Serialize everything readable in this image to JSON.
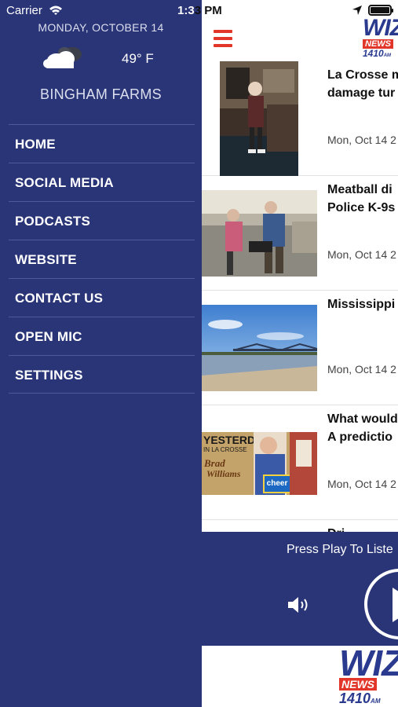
{
  "status_bar": {
    "carrier": "Carrier",
    "time_left": "1:3",
    "time_right": "3 PM",
    "icons": [
      "wifi-icon",
      "location-arrow-icon",
      "battery-icon"
    ]
  },
  "drawer": {
    "date": "MONDAY, OCTOBER 14",
    "weather_icon": "cloudy-icon",
    "temperature": "49° F",
    "location": "BINGHAM FARMS",
    "menu": [
      {
        "label": "HOME"
      },
      {
        "label": "SOCIAL MEDIA"
      },
      {
        "label": "PODCASTS"
      },
      {
        "label": "WEBSITE"
      },
      {
        "label": "CONTACT US"
      },
      {
        "label": "OPEN MIC"
      },
      {
        "label": "SETTINGS"
      }
    ]
  },
  "header": {
    "menu_icon": "hamburger-icon",
    "logo": {
      "word": "WIZ",
      "bar": "NEWS",
      "freq": "1410",
      "band": "AM"
    }
  },
  "stories": [
    {
      "title_line1": "La Crosse m",
      "title_line2": "damage tur",
      "date": "Mon, Oct 14 2"
    },
    {
      "title_line1": "Meatball di",
      "title_line2": "Police K-9s",
      "date": "Mon, Oct 14 2"
    },
    {
      "title_line1": "Mississippi",
      "title_line2": "",
      "date": "Mon, Oct 14 2"
    },
    {
      "title_line1": "What would",
      "title_line2": "A predictio",
      "date": "Mon, Oct 14 2",
      "thumb_text": {
        "line1": "YESTERDAY",
        "line2": "IN LA CROSSE",
        "name1": "Brad",
        "name2": "Williams",
        "box": "cheer"
      }
    },
    {
      "title_line1": "Dri",
      "title_line2": "",
      "date": ""
    }
  ],
  "player": {
    "prompt": "Press Play To Liste",
    "volume_icon": "speaker-icon",
    "play_icon": "play-icon"
  },
  "footer_logo": {
    "word": "WIZ",
    "bar": "NEWS",
    "freq": "1410",
    "band": "AM"
  },
  "colors": {
    "drawer_bg": "#2a3578",
    "accent_red": "#e2362a",
    "brand_blue": "#2a3a8f"
  }
}
